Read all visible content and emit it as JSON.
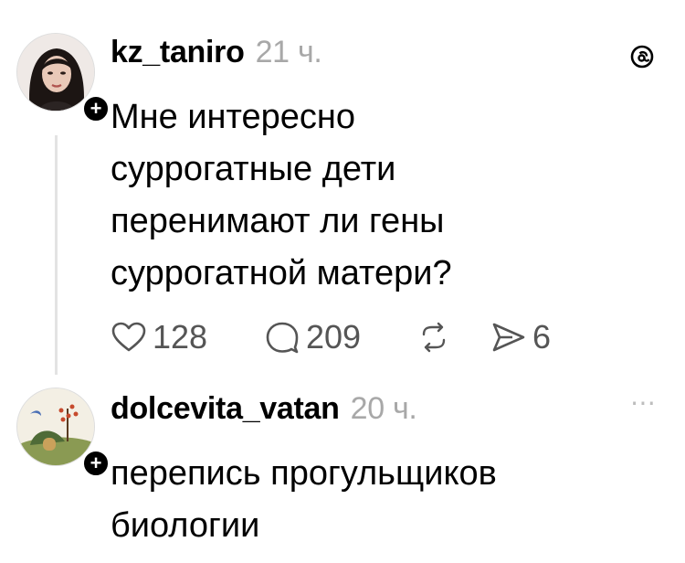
{
  "posts": [
    {
      "username": "kz_taniro",
      "time": "21 ч.",
      "text": "Мне интересно суррогатные дети перенимают ли гены суррогатной матери?",
      "lines": [
        "Мне интересно",
        "суррогатные дети",
        "перенимают ли гены",
        "суррогатной матери?"
      ],
      "likes": "128",
      "replies": "209",
      "shares": "6"
    },
    {
      "username": "dolcevita_vatan",
      "time": "20 ч.",
      "lines": [
        "перепись прогульщиков",
        "биологии"
      ]
    }
  ],
  "icons": {
    "app_logo": "threads-icon",
    "like": "heart-icon",
    "reply": "comment-icon",
    "repost": "repost-icon",
    "share": "send-icon",
    "more": "more-icon",
    "follow": "plus-icon"
  },
  "colors": {
    "text": "#000000",
    "muted": "#a8a8a8",
    "action": "#555555",
    "thread_line": "#e3e3e3"
  }
}
